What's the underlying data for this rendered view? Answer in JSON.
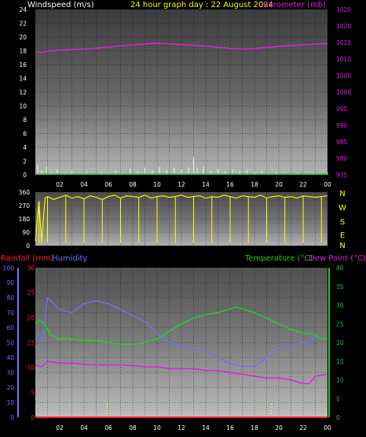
{
  "header": {
    "windspeed_label": "Windspeed (m/s)",
    "title": "24 hour graph day : 22 August 2024",
    "barometer_label": "Barometer (mb)"
  },
  "compass": [
    "N",
    "W",
    "S",
    "E",
    "N"
  ],
  "lower_header": {
    "rainfall_label": "Rainfall (mm)",
    "humidity_label": "Humidity",
    "temperature_label": "Temperature (°C)",
    "dewpoint_label": "Dew Point (°C)"
  },
  "colors": {
    "background": "#000000",
    "windspeed": "#e6e6e6",
    "barometer": "#e020e0",
    "direction": "#ffff00",
    "rain": "#ff2020",
    "humidity": "#7070ff",
    "temperature": "#20d020",
    "dewpoint": "#e020e0",
    "title": "#ffff00",
    "green_axis": "#22cc22"
  },
  "chart_data": [
    {
      "type": "line",
      "id": "wind-pressure",
      "x_ticks": [
        "02",
        "04",
        "06",
        "08",
        "10",
        "12",
        "14",
        "16",
        "18",
        "20",
        "22",
        "00"
      ],
      "xlim": [
        0,
        24
      ],
      "y_left_label": "Windspeed (m/s)",
      "y_left_ticks": [
        "0",
        "2",
        "4",
        "6",
        "8",
        "10",
        "12",
        "14",
        "16",
        "18",
        "20",
        "22",
        "24"
      ],
      "ylim_left": [
        0,
        24
      ],
      "y_right_label": "Barometer (mb)",
      "y_right_ticks": [
        "975",
        "980",
        "985",
        "990",
        "995",
        "1000",
        "1005",
        "1010",
        "1015",
        "1020",
        "1025"
      ],
      "ylim_right": [
        975,
        1025
      ],
      "series": [
        {
          "name": "Windspeed (m/s)",
          "axis": "left",
          "x": [
            0.2,
            0.5,
            0.9,
            1.3,
            1.8,
            2.4,
            3.0,
            3.6,
            4.2,
            4.8,
            5.4,
            6.0,
            6.6,
            7.2,
            7.8,
            8.4,
            9.0,
            9.6,
            10.2,
            10.8,
            11.4,
            12.0,
            12.6,
            13.0,
            13.3,
            13.8,
            14.4,
            15.0,
            15.6,
            16.2,
            16.8,
            17.4,
            18.0,
            18.6,
            19.2,
            19.8,
            20.4,
            21.0,
            21.6,
            22.2,
            22.8,
            23.4,
            24.0
          ],
          "y": [
            1.5,
            0.6,
            1.2,
            0.4,
            0.8,
            0.3,
            0.6,
            0.2,
            0.5,
            0.2,
            0.4,
            0.3,
            0.6,
            0.3,
            0.9,
            0.5,
            1.0,
            0.6,
            1.2,
            0.7,
            1.0,
            0.8,
            1.1,
            2.6,
            1.0,
            1.2,
            0.6,
            0.9,
            0.5,
            0.8,
            0.6,
            0.7,
            0.4,
            0.5,
            0.3,
            0.4,
            0.3,
            0.2,
            0.3,
            0.2,
            0.3,
            0.2,
            0.3
          ]
        },
        {
          "name": "Barometer (mb)",
          "axis": "right",
          "x": [
            0,
            0.5,
            1,
            2,
            4,
            6,
            8,
            10,
            12,
            14,
            16,
            17,
            18,
            20,
            22,
            24
          ],
          "y": [
            1012.3,
            1012.0,
            1012.4,
            1012.7,
            1013.0,
            1013.6,
            1014.3,
            1014.8,
            1014.4,
            1013.9,
            1013.2,
            1013.0,
            1013.2,
            1013.8,
            1014.3,
            1014.7
          ]
        }
      ]
    },
    {
      "type": "line",
      "id": "wind-direction",
      "x_ticks": [
        "02",
        "04",
        "06",
        "08",
        "10",
        "12",
        "14",
        "16",
        "18",
        "20",
        "22",
        "00"
      ],
      "xlim": [
        0,
        24
      ],
      "y_ticks": [
        "0",
        "90",
        "180",
        "270",
        "360"
      ],
      "ylim": [
        0,
        360
      ],
      "compass_labels": [
        "N",
        "W",
        "S",
        "E",
        "N"
      ],
      "series": [
        {
          "name": "Wind direction",
          "x": [
            0,
            0.3,
            0.5,
            0.8,
            1.0,
            1.5,
            2.0,
            2.5,
            3.0,
            3.5,
            4.0,
            4.5,
            5.0,
            5.5,
            6.0,
            6.5,
            7.0,
            7.5,
            8.0,
            8.5,
            9.0,
            9.5,
            10.0,
            10.5,
            11.0,
            11.5,
            12.0,
            12.5,
            13.0,
            13.5,
            14.0,
            14.5,
            15.0,
            15.5,
            16.0,
            16.5,
            17.0,
            17.5,
            18.0,
            18.5,
            19.0,
            19.5,
            20.0,
            20.5,
            21.0,
            21.5,
            22.0,
            22.5,
            23.0,
            23.5,
            24.0
          ],
          "y": [
            30,
            300,
            20,
            320,
            330,
            310,
            325,
            340,
            320,
            330,
            315,
            335,
            325,
            310,
            330,
            340,
            320,
            335,
            330,
            325,
            340,
            320,
            330,
            335,
            325,
            330,
            340,
            325,
            330,
            335,
            320,
            330,
            325,
            340,
            330,
            320,
            335,
            330,
            325,
            340,
            320,
            330,
            335,
            325,
            330,
            320,
            335,
            330,
            325,
            330,
            335
          ]
        }
      ]
    },
    {
      "type": "line",
      "id": "rain-humidity-temp",
      "x_ticks": [
        "02",
        "04",
        "06",
        "08",
        "10",
        "12",
        "14",
        "16",
        "18",
        "20",
        "22",
        "00"
      ],
      "xlim": [
        0,
        24
      ],
      "y_humidity_ticks": [
        "0",
        "10",
        "20",
        "30",
        "40",
        "50",
        "60",
        "70",
        "80",
        "90",
        "100"
      ],
      "ylim_humidity": [
        0,
        100
      ],
      "y_rain_ticks": [
        "0",
        "5",
        "10",
        "15",
        "20",
        "25",
        "30"
      ],
      "ylim_rain": [
        0,
        30
      ],
      "y_temp_ticks": [
        "0",
        "5",
        "10",
        "15",
        "20",
        "25",
        "30",
        "35",
        "40"
      ],
      "ylim_temp": [
        0,
        40
      ],
      "series": [
        {
          "name": "Rainfall (mm)",
          "axis": "rain",
          "x": [
            0,
            24
          ],
          "y": [
            0,
            0
          ]
        },
        {
          "name": "Humidity",
          "axis": "humidity",
          "x": [
            0,
            0.3,
            0.6,
            1.0,
            1.5,
            2.0,
            3.0,
            4.0,
            5.0,
            6.0,
            7.0,
            8.0,
            9.0,
            10.0,
            11.0,
            12.0,
            13.0,
            14.0,
            15.0,
            16.0,
            17.0,
            18.0,
            19.0,
            20.0,
            21.0,
            22.0,
            22.5,
            23.0,
            23.5,
            24.0
          ],
          "y": [
            52,
            56,
            50,
            80,
            76,
            72,
            70,
            76,
            78,
            76,
            72,
            68,
            64,
            56,
            50,
            48,
            46,
            44,
            40,
            36,
            34,
            34,
            40,
            46,
            48,
            50,
            50,
            54,
            53,
            52
          ]
        },
        {
          "name": "Temperature (°C)",
          "axis": "temp",
          "x": [
            0,
            0.3,
            0.8,
            1.2,
            2.0,
            3.0,
            4.0,
            5.0,
            6.0,
            7.0,
            8.0,
            9.0,
            10.0,
            11.0,
            12.0,
            13.0,
            14.0,
            15.0,
            16.0,
            16.5,
            17.0,
            18.0,
            19.0,
            20.0,
            21.0,
            22.0,
            22.5,
            23.0,
            23.5,
            24.0
          ],
          "y": [
            25,
            26,
            25,
            22,
            21,
            21,
            20.5,
            20.5,
            20,
            19.5,
            19.5,
            20,
            21,
            23,
            25,
            26.5,
            27.5,
            28,
            29,
            29.5,
            29,
            28,
            26.5,
            25,
            23.5,
            22.5,
            22.5,
            22,
            21,
            21
          ]
        },
        {
          "name": "Dew Point (°C)",
          "axis": "temp",
          "x": [
            0,
            0.5,
            1,
            2,
            3,
            4,
            5,
            6,
            7,
            8,
            9,
            10,
            11,
            12,
            13,
            14,
            15,
            16,
            17,
            18,
            19,
            20,
            21,
            22,
            22.5,
            23,
            24
          ],
          "y": [
            14,
            13.5,
            15,
            14.5,
            14.5,
            14.2,
            14,
            14,
            14,
            13.8,
            13.5,
            13.5,
            13,
            13,
            13,
            12.5,
            12.5,
            12,
            11.5,
            11,
            10.5,
            10.5,
            10,
            9,
            9,
            11,
            11.5
          ]
        }
      ]
    }
  ]
}
